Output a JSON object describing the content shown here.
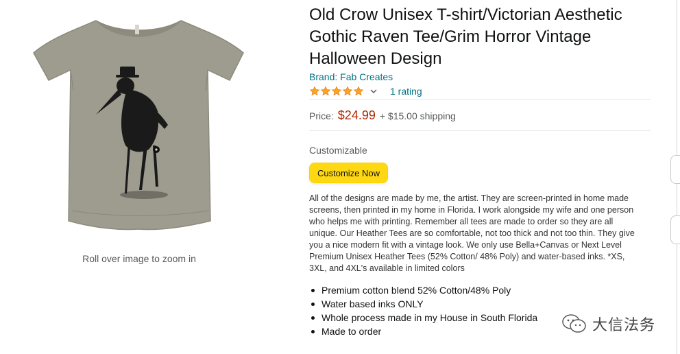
{
  "gallery": {
    "zoom_hint": "Roll over image to zoom in",
    "image_icon": "tshirt-crow-illustration-icon"
  },
  "product": {
    "title": "Old Crow Unisex T-shirt/Victorian Aesthetic Gothic Raven Tee/Grim Horror Vintage Halloween Design",
    "brand": "Brand: Fab Creates",
    "rating": {
      "stars": 5,
      "max_stars": 5,
      "count_label": "1 rating"
    },
    "price": {
      "label": "Price:",
      "value": "$24.99",
      "shipping": "+ $15.00 shipping"
    },
    "customizable_label": "Customizable",
    "customize_button": "Customize Now",
    "description": "All of the designs are made by me, the artist. They are screen-printed in home made screens, then printed in my home in Florida. I work alongside my wife and one person who helps me with printing. Remember all tees are made to order so they are all unique. Our Heather Tees are so comfortable, not too thick and not too thin. They give you a nice modern fit with a vintage look. We only use Bella+Canvas or Next Level Premium Unisex Heather Tees (52% Cotton/ 48% Poly) and water-based inks. *XS, 3XL, and 4XL's available in limited colors",
    "bullets": [
      "Premium cotton blend 52% Cotton/48% Poly",
      "Water based inks ONLY",
      "Whole process made in my House in South Florida",
      "Made to order"
    ]
  },
  "watermark": {
    "text": "大信法务",
    "icon": "wechat-icon"
  },
  "colors": {
    "link": "#007185",
    "price": "#b12704",
    "button": "#ffd814",
    "star": "#ffa41c"
  }
}
